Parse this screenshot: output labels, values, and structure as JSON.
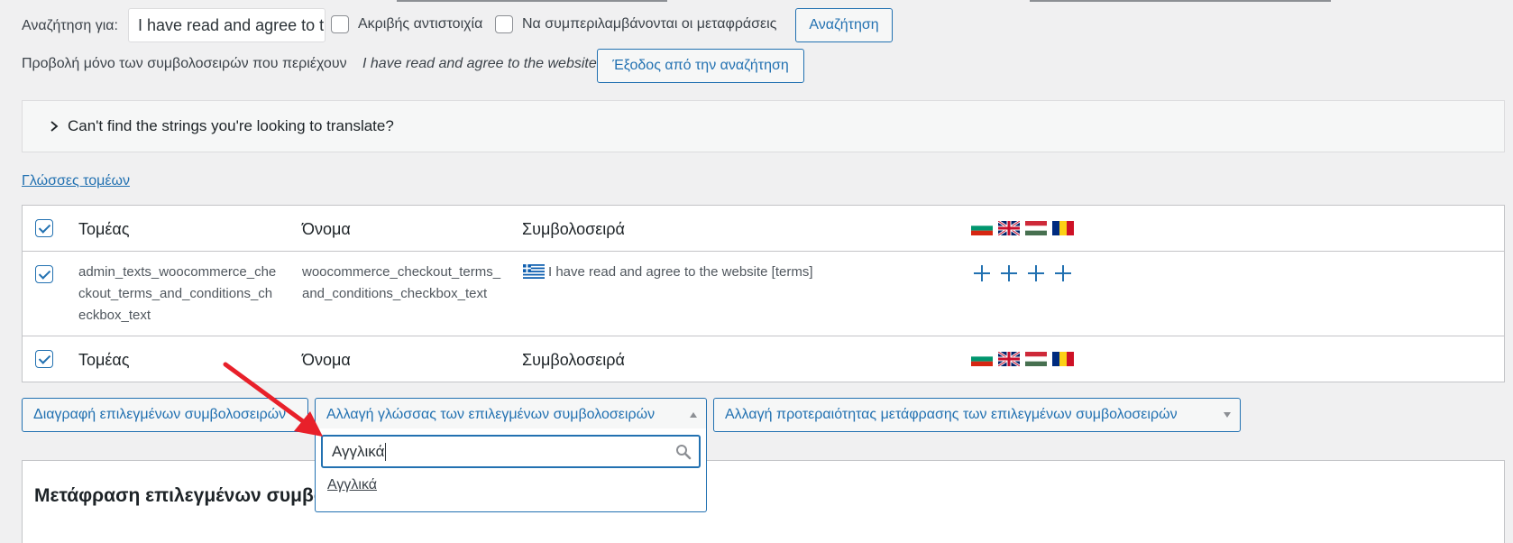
{
  "search": {
    "label": "Αναζήτηση για:",
    "value": "I have read and agree to the website",
    "exact_match_label": "Ακριβής αντιστοιχία",
    "include_translations_label": "Να συμπεριλαμβάνονται οι μεταφράσεις",
    "search_button": "Αναζήτηση"
  },
  "filter_notice": {
    "prefix": "Προβολή μόνο των συμβολοσειρών που περιέχουν",
    "term": "I have read and agree to the website",
    "exit_button": "Έξοδος από την αναζήτηση"
  },
  "collapse": {
    "label": "Can't find the strings you're looking to translate?"
  },
  "domain_languages_link": "Γλώσσες τομέων",
  "table": {
    "headers": {
      "domain": "Τομέας",
      "name": "Όνομα",
      "string": "Συμβολοσειρά"
    },
    "rows": [
      {
        "domain": "admin_texts_woocommerce_checkout_terms_and_conditions_checkbox_text",
        "name": "woocommerce_checkout_terms_and_conditions_checkbox_text",
        "string": "I have read and agree to the website [terms]",
        "source_flag": "greece-flag-icon",
        "checked": true
      }
    ],
    "flags": [
      "bulgaria-flag-icon",
      "uk-flag-icon",
      "hungary-flag-icon",
      "romania-flag-icon"
    ]
  },
  "actions": {
    "delete_button": "Διαγραφή επιλεγμένων συμβολοσειρών",
    "change_language_select": "Αλλαγή γλώσσας των επιλεγμένων συμβολοσειρών",
    "change_priority_select": "Αλλαγή προτεραιότητας μετάφρασης των επιλεγμένων συμβολοσειρών"
  },
  "language_dropdown": {
    "search_value": "Αγγλικά",
    "options": [
      "Αγγλικά"
    ]
  },
  "bottom_section": {
    "title": "Μετάφραση επιλεγμένων συμβολοσειρών"
  },
  "colors": {
    "accent": "#2271b1",
    "arrow": "#e8202a",
    "background": "#f0f0f1"
  }
}
